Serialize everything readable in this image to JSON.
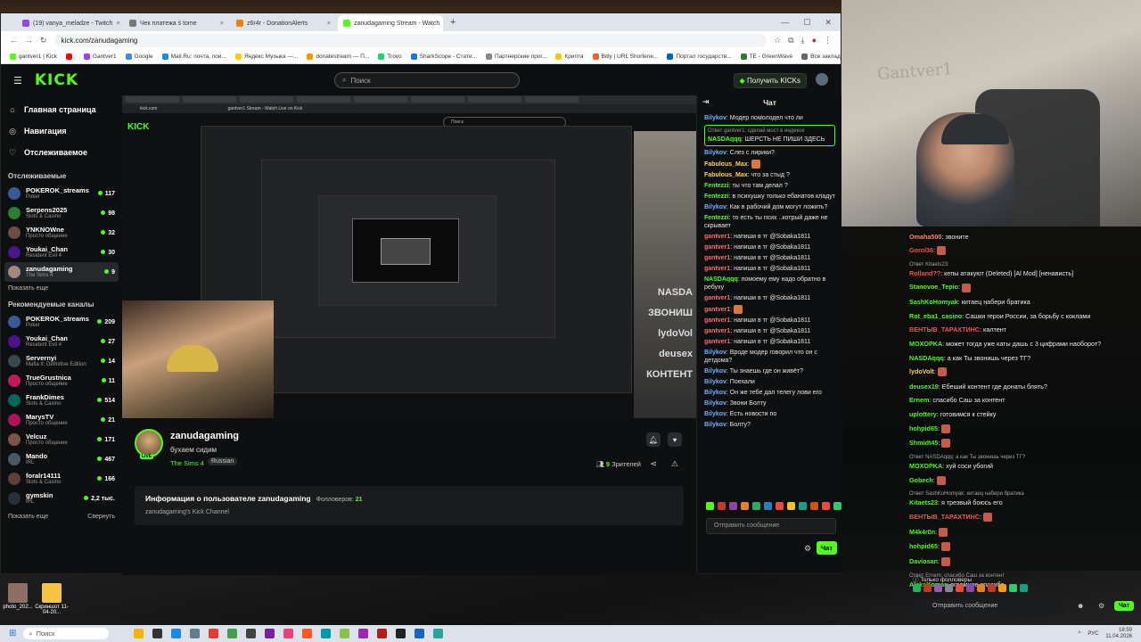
{
  "browser": {
    "tabs": [
      {
        "title": "(19) vanya_meladze - Twitch",
        "color": "#9146ff",
        "active": false
      },
      {
        "title": "Чек платежа ś tome",
        "color": "#777777",
        "active": false
      },
      {
        "title": "z6r4r - DonationAlerts",
        "color": "#f57d07",
        "active": false
      },
      {
        "title": "zanudagaming Stream - Watch",
        "color": "#53fc18",
        "active": true
      }
    ],
    "url": "kick.com/zanudagaming",
    "bookmarks": [
      {
        "label": "gantver1 | Kick",
        "color": "#53fc18"
      },
      {
        "label": "",
        "color": "#ff0000"
      },
      {
        "label": "Gantver1",
        "color": "#9146ff"
      },
      {
        "label": "Google",
        "color": "#4285f4"
      },
      {
        "label": "Mail.Ru: почта, пои...",
        "color": "#168de2"
      },
      {
        "label": "Яндекс Музыка —...",
        "color": "#ffcc00"
      },
      {
        "label": "donatestream — П...",
        "color": "#ff9800"
      },
      {
        "label": "Trovo",
        "color": "#19d66b"
      },
      {
        "label": "SharkScope - Стати...",
        "color": "#1a73e8"
      },
      {
        "label": "Партнерские прог...",
        "color": "#888888"
      },
      {
        "label": "Крипта",
        "color": "#f7c600"
      },
      {
        "label": "Bitly | URL Shortene...",
        "color": "#ee6123"
      },
      {
        "label": "Портал государств...",
        "color": "#0066b3"
      },
      {
        "label": "TE - GreenWave",
        "color": "#2e7d32"
      },
      {
        "label": "Все закладки",
        "color": "#666666"
      }
    ]
  },
  "kick": {
    "logo": "KICK",
    "search_placeholder": "Поиск",
    "get_kicks": "Получить KICKs",
    "nav": [
      {
        "label": "Главная страница",
        "icon": "home-icon"
      },
      {
        "label": "Навигация",
        "icon": "compass-icon"
      },
      {
        "label": "Отслеживаемое",
        "icon": "heart-icon"
      }
    ],
    "following_title": "Отслеживаемые",
    "following": [
      {
        "name": "POKEROK_streams",
        "category": "Poker",
        "viewers": "117",
        "color": "#3b5998"
      },
      {
        "name": "Serpens2025",
        "category": "Slots & Casino",
        "viewers": "98",
        "color": "#2e7d32"
      },
      {
        "name": "YNKNOWne",
        "category": "Просто общение",
        "viewers": "32",
        "color": "#6d4c41"
      },
      {
        "name": "Youkai_Chan",
        "category": "Resident Evil 4",
        "viewers": "30",
        "color": "#4a148c"
      },
      {
        "name": "zanudagaming",
        "category": "The Sims 4",
        "viewers": "9",
        "color": "#a1887f"
      }
    ],
    "show_more": "Показать еще",
    "recommended_title": "Рекомендуемые каналы",
    "recommended": [
      {
        "name": "POKEROK_streams",
        "category": "Poker",
        "viewers": "209",
        "color": "#3b5998"
      },
      {
        "name": "Youkai_Chan",
        "category": "Resident Evil 4",
        "viewers": "27",
        "color": "#4a148c"
      },
      {
        "name": "Servernyi",
        "category": "Mafia II: Definitive Edition",
        "viewers": "14",
        "color": "#37474f"
      },
      {
        "name": "TrueGrustnica",
        "category": "Просто общение",
        "viewers": "11",
        "color": "#c2185b"
      },
      {
        "name": "FrankDimes",
        "category": "Slots & Casino",
        "viewers": "514",
        "color": "#00695c"
      },
      {
        "name": "MarysTV",
        "category": "Просто общение",
        "viewers": "21",
        "color": "#ad1457"
      },
      {
        "name": "Velcuz",
        "category": "Просто общение",
        "viewers": "171",
        "color": "#795548"
      },
      {
        "name": "Mando",
        "category": "IRL",
        "viewers": "467",
        "color": "#455a64"
      },
      {
        "name": "foralr14111",
        "category": "Slots & Casino",
        "viewers": "166",
        "color": "#5d4037"
      },
      {
        "name": "gymskin",
        "category": "IRL",
        "viewers": "2,2 тыс.",
        "color": "#263238"
      }
    ],
    "footer_more": "Показать еще",
    "footer_collapse": "Свернуть"
  },
  "player": {
    "inner_url": "kick.com",
    "inner_title": "gantver1 Stream - Watch Live on Kick",
    "inner_search": "Поиск",
    "overlay_words": [
      "NASDA",
      "ЗВОНИШ",
      "lydoVol",
      "deusex",
      "КОНТЕНТ"
    ]
  },
  "stream": {
    "name": "zanudagaming",
    "title": "бухаем сидим",
    "category": "The Sims 4",
    "language": "Russian",
    "live_badge": "LIVE",
    "viewers_count": "9",
    "viewers_label": "Зрителей",
    "about_title": "Информация о пользователе zanudagaming",
    "followers_label": "Фолловеров:",
    "followers_count": "21",
    "about_sub": "zanudagaming's Kick Channel"
  },
  "chat": {
    "title": "Чат",
    "messages": [
      {
        "user": "Bilykov",
        "color": "#6db4ff",
        "text": "Модер помолодел что ли"
      },
      {
        "reply": "Ответ gantver1: сделай мост в индексе",
        "user": "NASDAqqq",
        "color": "#53fc18",
        "text": "ШЕРСТЬ НЕ ПИШИ ЗДЕСЬ",
        "pinned": true
      },
      {
        "user": "Bilykov",
        "color": "#6db4ff",
        "text": "Слез с лирики?"
      },
      {
        "user": "Fabulous_Max",
        "color": "#ffd54f",
        "text": ""
      },
      {
        "user": "Fabulous_Max",
        "color": "#ffd54f",
        "text": "что за стыд ?"
      },
      {
        "user": "Fentezzi",
        "color": "#53fc18",
        "text": "ты что там делал ?"
      },
      {
        "user": "Fentezzi",
        "color": "#53fc18",
        "text": "в психушку только ебанатов кладут"
      },
      {
        "user": "Bilykov",
        "color": "#6db4ff",
        "text": "Как в рабочий дом могут ложить?"
      },
      {
        "user": "Fentezzi",
        "color": "#53fc18",
        "text": "то есть ты псих ..котрый даже не скрывает"
      },
      {
        "user": "gantver1",
        "color": "#ff6b6b",
        "text": "напиши в тг @Sobaka1811"
      },
      {
        "user": "gantver1",
        "color": "#ff6b6b",
        "text": "напиши в тг @Sobaka1811"
      },
      {
        "user": "gantver1",
        "color": "#ff6b6b",
        "text": "напиши в тг @Sobaka1811"
      },
      {
        "user": "gantver1",
        "color": "#ff6b6b",
        "text": "напиши в тг @Sobaka1811"
      },
      {
        "user": "NASDAqqq",
        "color": "#53fc18",
        "text": "помоему ему надо обратно в ребуху"
      },
      {
        "user": "gantver1",
        "color": "#ff6b6b",
        "text": "напиши в тг @Sobaka1811"
      },
      {
        "user": "gantver1",
        "color": "#ff6b6b",
        "text": ""
      },
      {
        "user": "gantver1",
        "color": "#ff6b6b",
        "text": "напиши в тг @Sobaka1811"
      },
      {
        "user": "gantver1",
        "color": "#ff6b6b",
        "text": "напиши в тг @Sobaka1811"
      },
      {
        "user": "gantver1",
        "color": "#ff6b6b",
        "text": "напиши в тг @Sobaka1811"
      },
      {
        "user": "Bilykov",
        "color": "#6db4ff",
        "text": "Вроде модер говорил что он с детдома?"
      },
      {
        "user": "Bilykov",
        "color": "#6db4ff",
        "text": "Ты знаешь где он живёт?"
      },
      {
        "user": "Bilykov",
        "color": "#6db4ff",
        "text": "Поехали"
      },
      {
        "user": "Bilykov",
        "color": "#6db4ff",
        "text": "Он же тебе дал телегу лови его"
      },
      {
        "user": "Bilykov",
        "color": "#6db4ff",
        "text": "Звони Болту"
      },
      {
        "user": "Bilykov",
        "color": "#6db4ff",
        "text": "Есть новости по"
      },
      {
        "user": "Bilykov",
        "color": "#6db4ff",
        "text": "Болту?"
      }
    ],
    "input_placeholder": "Отправить сообщение",
    "send": "Чат"
  },
  "overlay": {
    "watermark": "Gantver1",
    "messages": [
      {
        "user": "Omaha500",
        "color": "#ff8a65",
        "text": "звоните"
      },
      {
        "user": "Gorol36",
        "color": "#ff5252",
        "text": ""
      },
      {
        "reply": "Ответ Kitaets23:",
        "user": "Rolland??",
        "color": "#ff5252",
        "text": "кепы атакуют (Deleted)  [Al Mod] [ненависть]"
      },
      {
        "user": "Stanovoe_Tepio",
        "color": "#53fc18",
        "text": ""
      },
      {
        "user": "SashKoHomyak",
        "color": "#53fc18",
        "text": "китаец набери братика"
      },
      {
        "user": "Rot_eba1_casino",
        "color": "#53fc18",
        "text": "Сашки герои России, за борьбу с коклами"
      },
      {
        "user": "ВЕНТЫВ_ТАРАХТИНС",
        "color": "#ff5252",
        "text": "калтент"
      },
      {
        "user": "MOXOPKA",
        "color": "#53fc18",
        "text": "может тогда уже каты дашь с 3 цифрами наоборот?"
      },
      {
        "user": "NASDAqqq",
        "color": "#53fc18",
        "text": "а как Ты звонишь через ТГ?"
      },
      {
        "user": "lydoVolt",
        "color": "#ffd54f",
        "text": ""
      },
      {
        "user": "deusex19",
        "color": "#53fc18",
        "text": "Ебеший контент где донаты блять?"
      },
      {
        "user": "Ernem",
        "color": "#53fc18",
        "text": "спасибо Саш за контент"
      },
      {
        "user": "uplottery",
        "color": "#53fc18",
        "text": "готовимся к стейку"
      },
      {
        "user": "hohpid65",
        "color": "#53fc18",
        "text": ""
      },
      {
        "user": "Shmidt45",
        "color": "#53fc18",
        "text": ""
      },
      {
        "reply": "Ответ NASDAqqq: а как Ты звонишь через ТГ?",
        "user": "MOXOPKA",
        "color": "#53fc18",
        "text": "хуй соси убогий"
      },
      {
        "user": "Gobech",
        "color": "#53fc18",
        "text": ""
      },
      {
        "reply": "Ответ SashKoHomyak: китаец набери братика",
        "user": "Kitaets23",
        "color": "#53fc18",
        "text": "я трезвый боюсь его"
      },
      {
        "user": "ВЕНТЫВ_ТАРАХТИНС",
        "color": "#ff5252",
        "text": ""
      },
      {
        "user": "M4k4r0n",
        "color": "#53fc18",
        "text": ""
      },
      {
        "user": "hohpid65",
        "color": "#53fc18",
        "text": ""
      },
      {
        "user": "Daviosan",
        "color": "#53fc18",
        "text": ""
      },
      {
        "reply": "Ответ Ernem: спасибо Саш за контент",
        "user": "AleksKomar",
        "color": "#53fc18",
        "text": "огромное спасибо"
      }
    ],
    "followers_only": "Только фолловеры",
    "input_placeholder": "Отправить сообщение",
    "send": "Чат"
  },
  "desktop": {
    "icons": [
      {
        "label": "photo_202...",
        "color": "#8d6e63"
      },
      {
        "label": "Скриншот 11-04-20...",
        "color": "#f5c542"
      }
    ]
  },
  "taskbar": {
    "search": "Поиск",
    "lang": "РУС",
    "time": "18:59",
    "date": "11.04.2026"
  }
}
